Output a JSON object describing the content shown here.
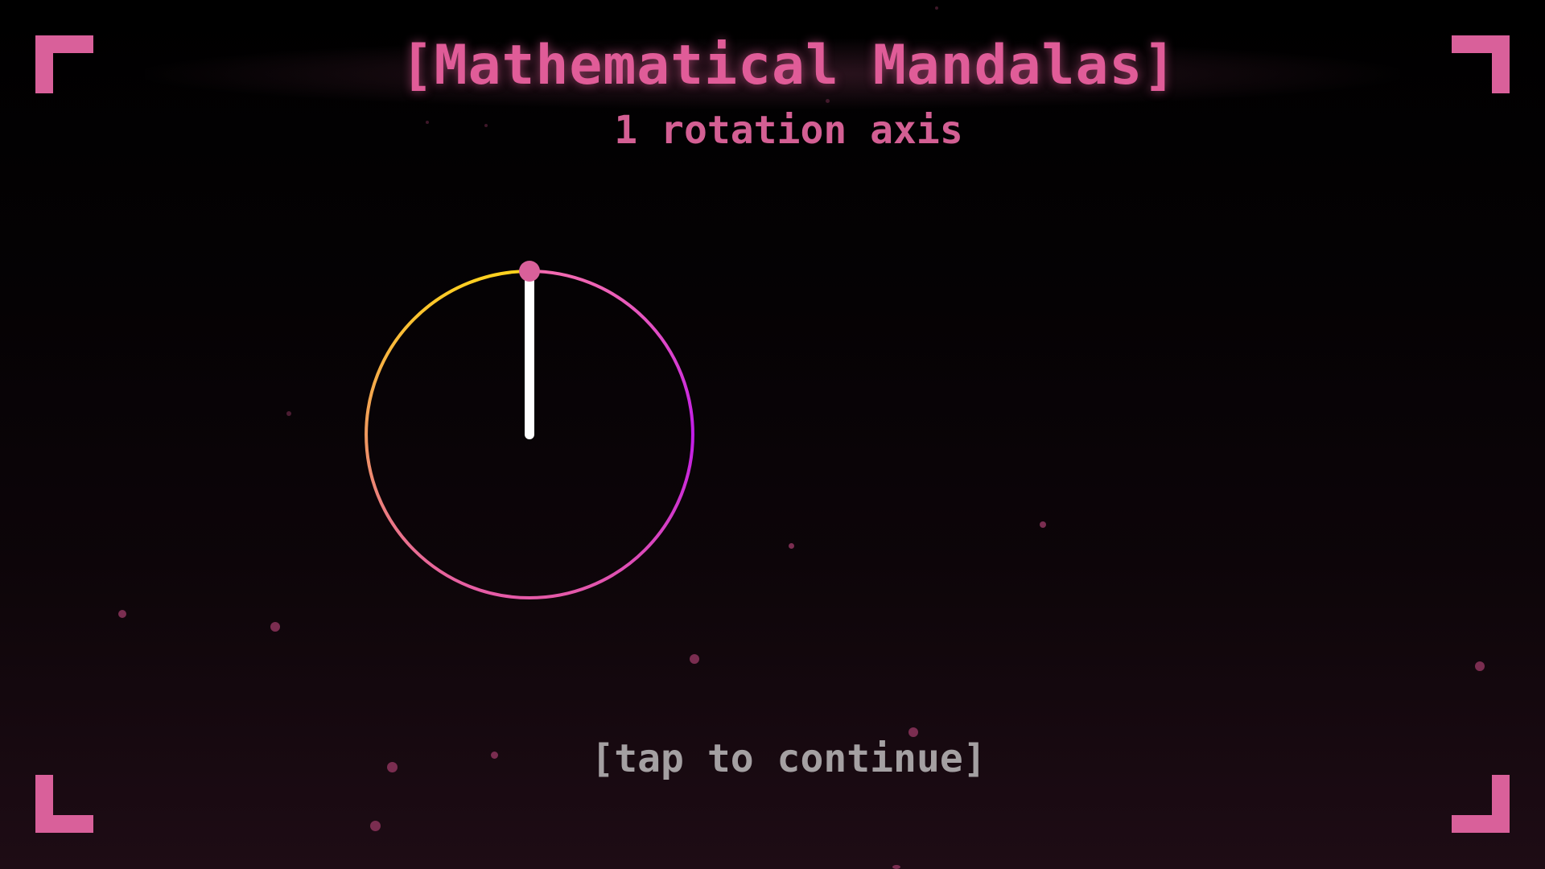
{
  "screen": {
    "title": "[Mathematical Mandalas]",
    "subtitle": "1 rotation axis",
    "continue_prompt": "[tap to continue]"
  },
  "mandala": {
    "rotation_axes": 1,
    "ring_colors": [
      "#ffd21e",
      "#f26ab0",
      "#c21ce8",
      "#e55aa8",
      "#f19a5e"
    ],
    "handle_color": "#d9609a",
    "spoke_color": "#ffffff"
  },
  "colors": {
    "accent": "#d9609a",
    "title": "#e05c98",
    "subtitle": "#d35f93",
    "prompt": "#a4a0a2",
    "background_top": "#000000",
    "background_bottom": "#1e0c15"
  }
}
